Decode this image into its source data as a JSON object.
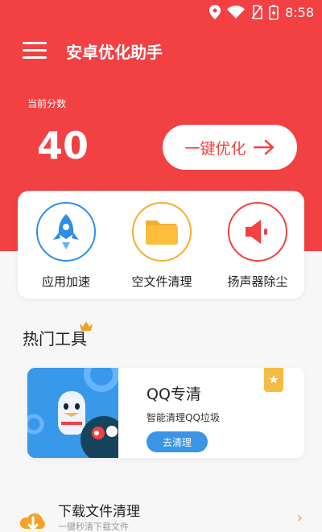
{
  "status_bar": {
    "time": "8:58",
    "icons": [
      "location-icon",
      "wifi-icon",
      "no-sim-icon",
      "battery-charging-icon"
    ]
  },
  "header": {
    "title": "安卓优化助手",
    "score_label": "当前分数",
    "score": "40",
    "optimize_button": "一键优化"
  },
  "quick_actions": [
    {
      "label": "应用加速",
      "icon": "rocket-icon",
      "color": "#2d8ee8"
    },
    {
      "label": "空文件清理",
      "icon": "folder-icon",
      "color": "#f5ad2f"
    },
    {
      "label": "扬声器除尘",
      "icon": "speaker-icon",
      "color": "#f24043"
    }
  ],
  "hot_tools": {
    "title": "热门工具",
    "card": {
      "title": "QQ专清",
      "description": "智能清理QQ垃圾",
      "button": "去清理"
    }
  },
  "list": [
    {
      "title": "下载文件清理",
      "subtitle": "一键秒清下载文件",
      "icon": "download-cloud-icon"
    }
  ],
  "colors": {
    "primary": "#f24043",
    "blue": "#3898e9",
    "orange": "#f4a12a"
  }
}
